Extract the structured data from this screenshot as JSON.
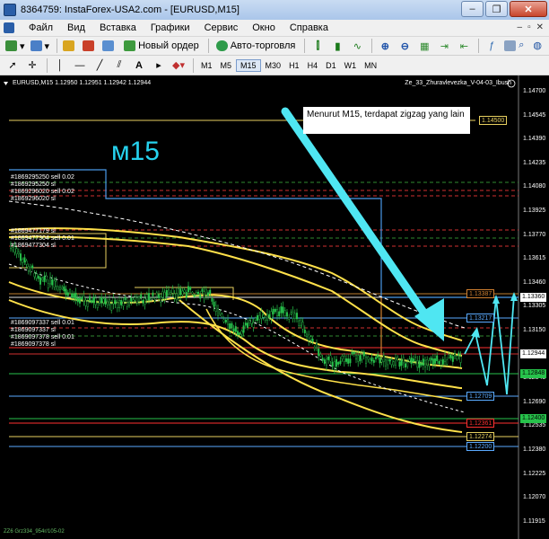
{
  "window": {
    "title": "8364759: InstaForex-USA2.com - [EURUSD,M15]",
    "min": "–",
    "max": "❐",
    "close": "✕"
  },
  "menu": {
    "items": [
      "Файл",
      "Вид",
      "Вставка",
      "Графики",
      "Сервис",
      "Окно",
      "Справка"
    ],
    "right": [
      "–",
      "▫",
      "✕"
    ]
  },
  "toolbar": {
    "new_order": "Новый ордер",
    "autotrading": "Авто-торговля",
    "timeframes": [
      "M1",
      "M5",
      "M15",
      "M30",
      "H1",
      "H4",
      "D1",
      "W1",
      "MN"
    ],
    "active_tf": "M15"
  },
  "chart": {
    "symbol_line": "EURUSD,M15  1.12950 1.12951 1.12942 1.12944",
    "indicator": "Ze_33_Zhuravlevezka_V-04-03_Ibush",
    "big_label": "м15",
    "annotation": "Menurut M15, terdapat zigzag yang lain",
    "footer": "ZZ6 Grz334_954r/105-02",
    "orders_top": [
      "#1869295250 sell 0.02",
      "#1869295250 sl",
      "#1869296020 sell 0.02",
      "#1869296020 sl"
    ],
    "orders_mid": [
      "#1869477179 sl",
      "#1869477304 sell 0.01",
      "#1869477304 sl"
    ],
    "orders_low": [
      "#1869097337 sell 0.01",
      "#1869097337 sl",
      "#1869097378 sell 0.01",
      "#1869097378 sl"
    ],
    "price_levels": [
      "1.14700",
      "1.14545",
      "1.14390",
      "1.14235",
      "1.14080",
      "1.13925",
      "1.13770",
      "1.13615",
      "1.13460",
      "1.13305",
      "1.13150",
      "1.12995",
      "1.12845",
      "1.12690",
      "1.12535",
      "1.12380",
      "1.12225",
      "1.12070",
      "1.11915"
    ],
    "boxed_prices": {
      "p14500": "1.14500",
      "p13387": "1.13387",
      "p13360": "1.13360",
      "p13217": "1.13217",
      "p12944": "1.12944",
      "p12848": "1.12848",
      "p12709": "1.12709",
      "p12400": "1.12400",
      "p12361": "1.12361",
      "p12274": "1.12274",
      "p12200": "1.12200"
    },
    "colors": {
      "background": "#000000",
      "candles": "#27c24b",
      "bands": "#ffe14a",
      "arrows": "#4fe6f2",
      "levels_red": "#ff3030",
      "levels_blue": "#5aaaff"
    }
  }
}
